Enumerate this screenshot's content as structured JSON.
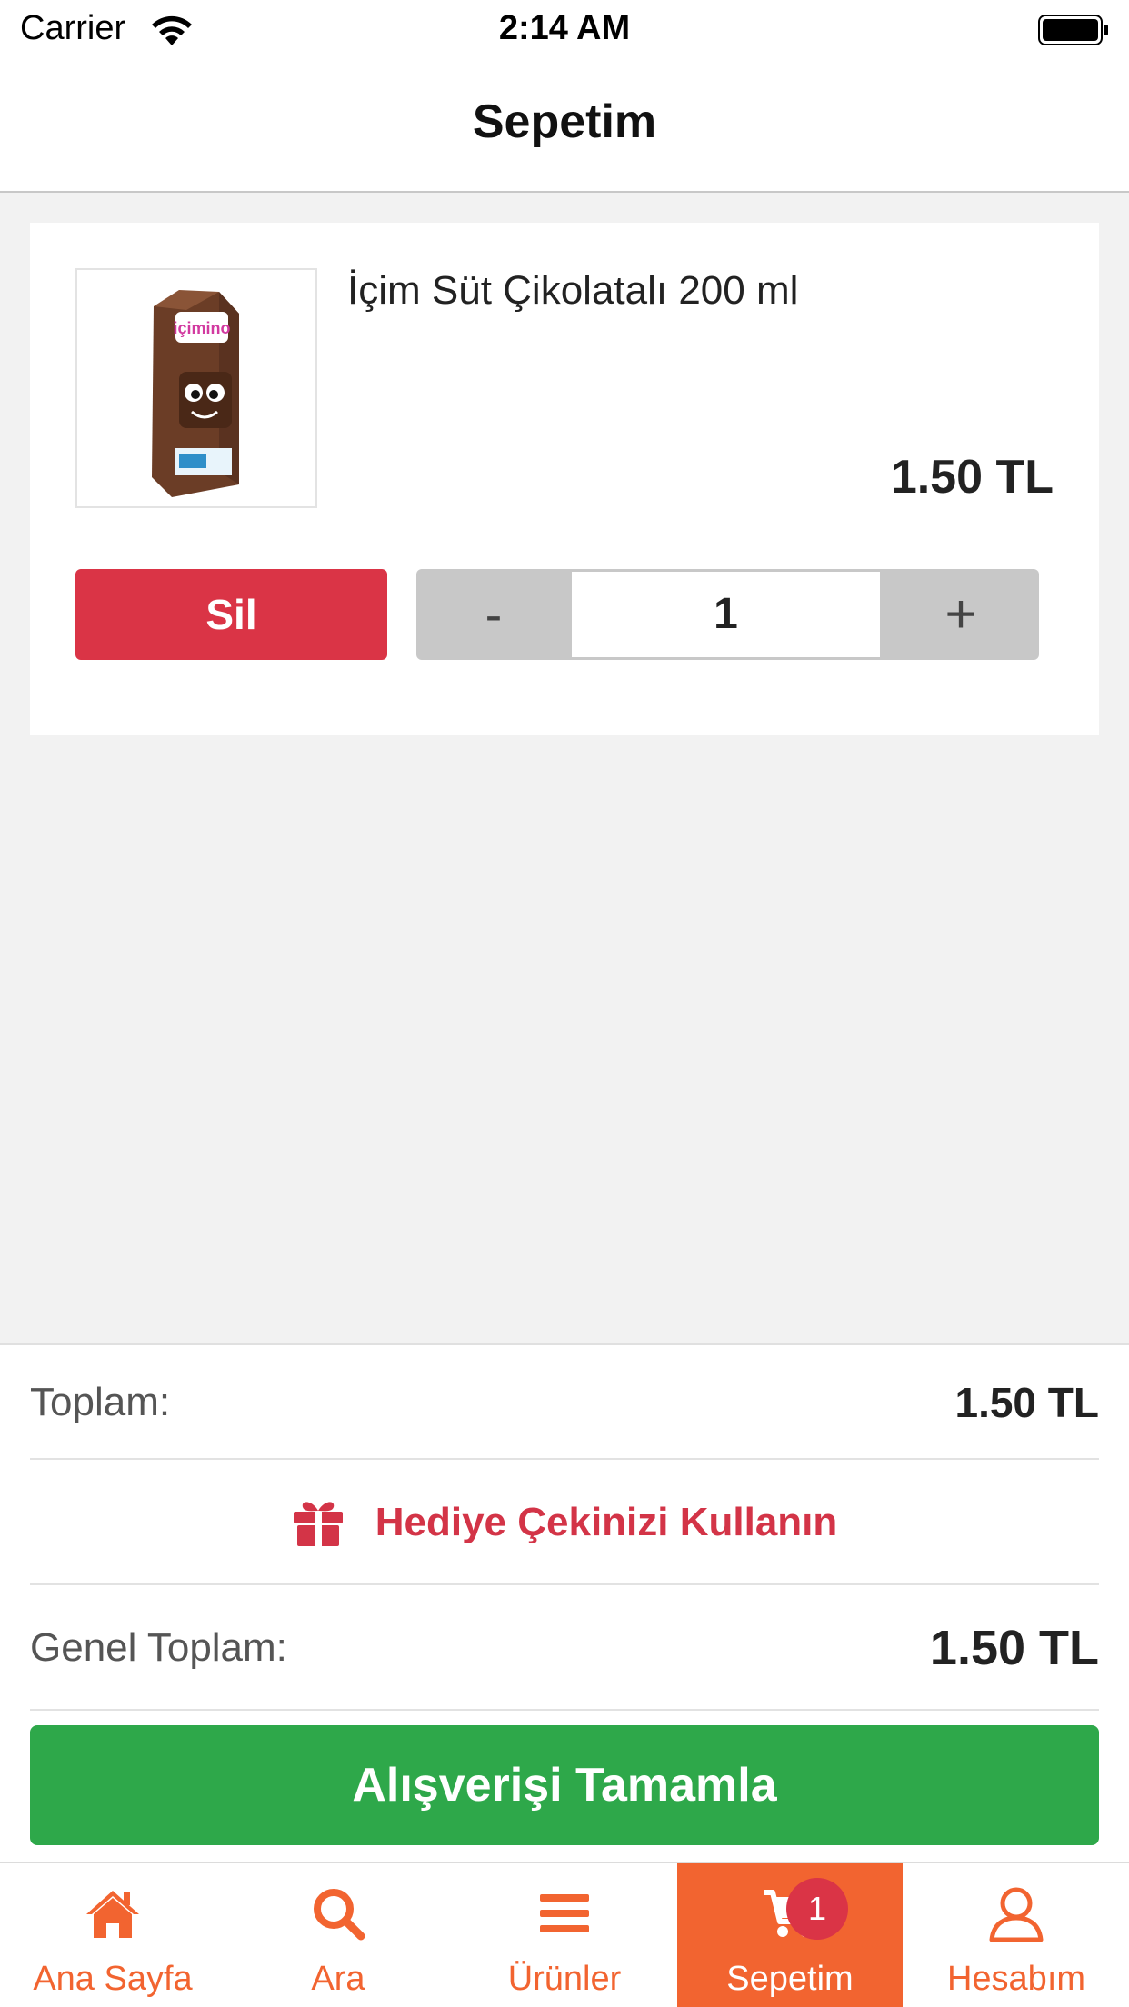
{
  "status_bar": {
    "carrier": "Carrier",
    "time": "2:14 AM"
  },
  "nav": {
    "title": "Sepetim"
  },
  "cart_item": {
    "name": "İçim Süt Çikolatalı 200 ml",
    "price": "1.50 TL",
    "delete_label": "Sil",
    "minus_label": "-",
    "quantity": "1",
    "plus_label": "+",
    "image_icon": "chocolate-milk-carton-image"
  },
  "summary": {
    "subtotal_label": "Toplam:",
    "subtotal_value": "1.50 TL",
    "gift_label": "Hediye Çekinizi Kullanın",
    "total_label": "Genel Toplam:",
    "total_value": "1.50 TL",
    "checkout_label": "Alışverişi Tamamla"
  },
  "tabs": [
    {
      "label": "Ana Sayfa",
      "icon": "home-icon",
      "active": false
    },
    {
      "label": "Ara",
      "icon": "search-icon",
      "active": false
    },
    {
      "label": "Ürünler",
      "icon": "menu-icon",
      "active": false
    },
    {
      "label": "Sepetim",
      "icon": "cart-icon",
      "active": true,
      "badge": "1"
    },
    {
      "label": "Hesabım",
      "icon": "user-icon",
      "active": false
    }
  ],
  "colors": {
    "accent": "#f26430",
    "danger": "#da3446",
    "success": "#2ea84a"
  }
}
